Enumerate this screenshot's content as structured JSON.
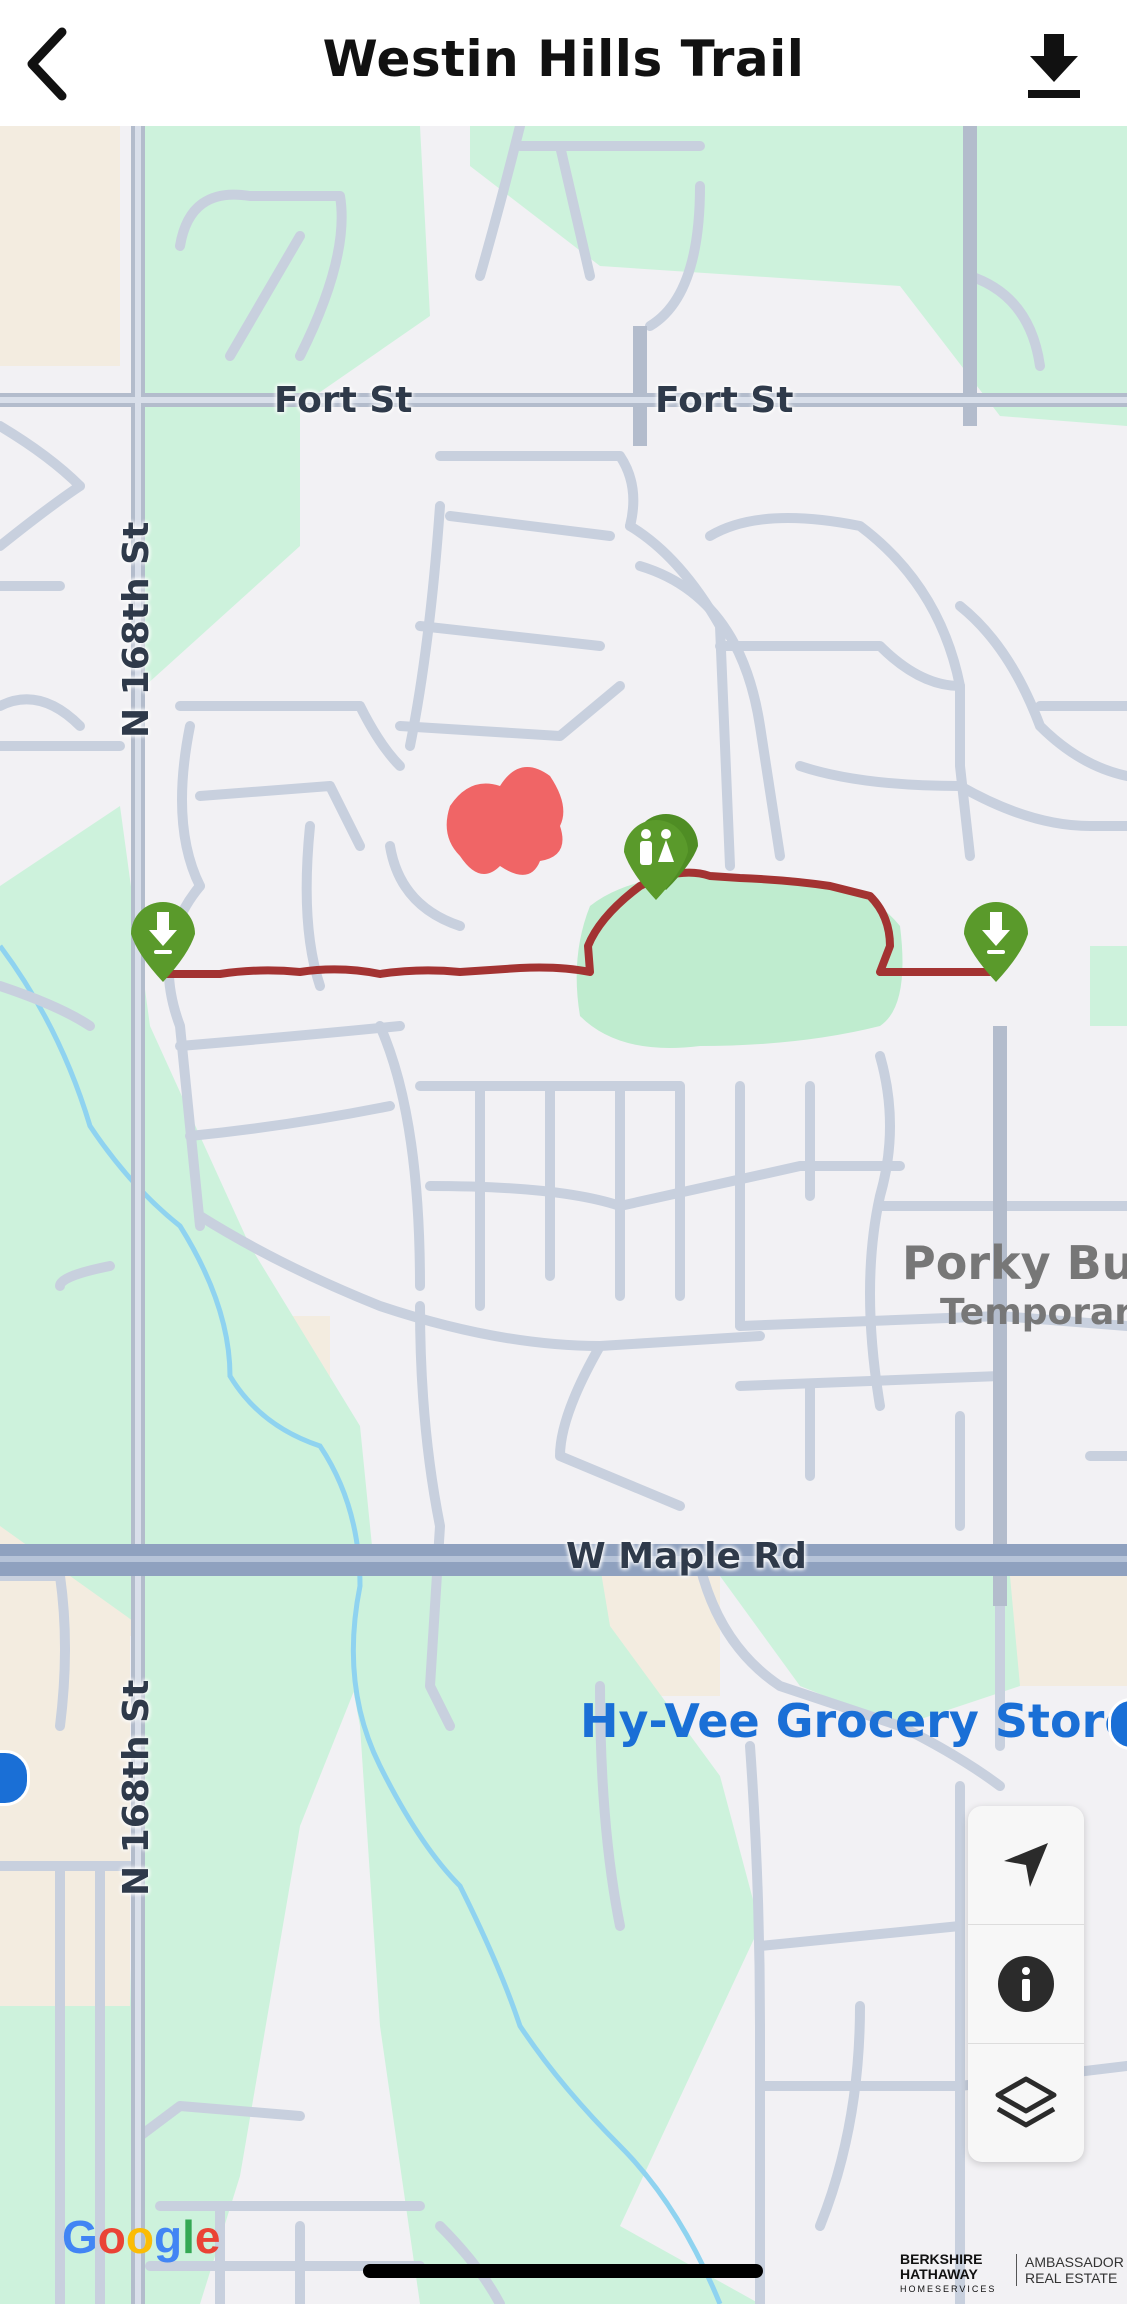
{
  "header": {
    "title": "Westin Hills Trail",
    "back_icon": "chevron-left-icon",
    "download_icon": "download-icon"
  },
  "map": {
    "road_labels": {
      "fort_st_1": "Fort St",
      "fort_st_2": "Fort St",
      "n168_1": "N 168th St",
      "n168_2": "N 168th St",
      "maple": "W Maple Rd"
    },
    "poi": {
      "name": "Porky Butt",
      "subtitle": "Temporarily"
    },
    "store": {
      "name": "Hy-Vee Grocery Store"
    },
    "markers": {
      "trailhead_start": "trailhead-pin-icon",
      "trailhead_end": "trailhead-pin-icon",
      "restroom": "restroom-pin-icon"
    },
    "colors": {
      "trail": "#a33332",
      "park": "#c9f0d9",
      "road": "#c5cddb",
      "highway": "#8fa1bf",
      "pin": "#5a9a2b",
      "store": "#1a6fd6"
    },
    "attribution": "Google"
  },
  "controls": {
    "locate_icon": "navigation-arrow-icon",
    "info_icon": "info-icon",
    "layers_icon": "layers-icon"
  },
  "branding": {
    "line1": "BERKSHIRE",
    "line2": "HATHAWAY",
    "line3": "HOMESERVICES",
    "right1": "AMBASSADOR",
    "right2": "REAL ESTATE"
  }
}
